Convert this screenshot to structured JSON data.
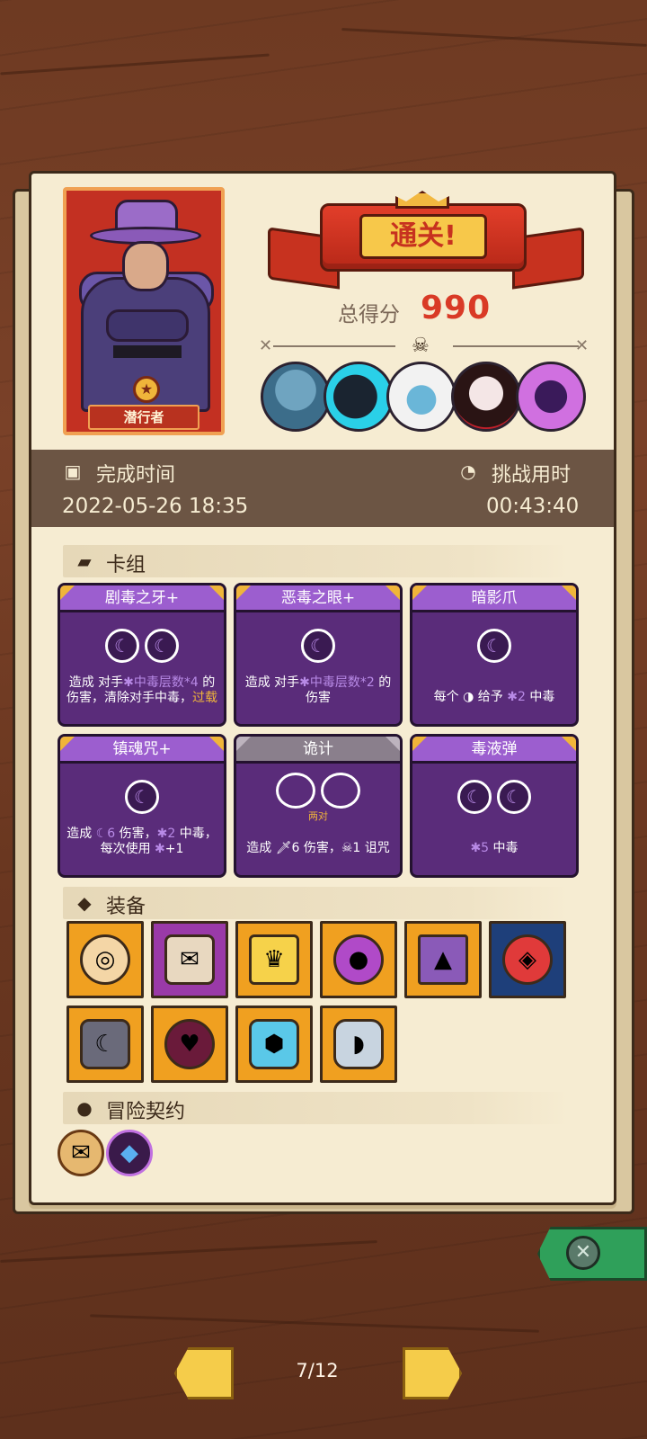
{
  "character": {
    "class_name": "潜行者"
  },
  "result": {
    "banner": "通关!",
    "score_label": "总得分",
    "score_value": "990"
  },
  "bosses": [
    "boss-portrait",
    "boss-portrait",
    "boss-portrait",
    "boss-portrait",
    "boss-portrait"
  ],
  "times": {
    "complete_label": "完成时间",
    "complete_value": "2022-05-26 18:35",
    "challenge_label": "挑战用时",
    "challenge_value": "00:43:40"
  },
  "sections": {
    "deck": "卡组",
    "equipment": "装备",
    "contract": "冒险契约"
  },
  "cards": [
    {
      "name": "剧毒之牙+",
      "orbs": 2,
      "desc_parts": [
        "造成 对手",
        "中毒层数*4",
        " 的伤害，清除对手中毒，",
        "过载"
      ]
    },
    {
      "name": "恶毒之眼+",
      "orbs": 1,
      "desc_parts": [
        "造成 对手",
        "中毒层数*2",
        " 的伤害"
      ]
    },
    {
      "name": "暗影爪",
      "orbs": 1,
      "desc_parts": [
        "每个 ",
        "◑",
        " 给予 ",
        "2",
        " 中毒"
      ]
    },
    {
      "name": "镇魂咒+",
      "orbs": 1,
      "desc_parts": [
        "造成 ",
        "6",
        " 伤害，",
        "2",
        " 中毒，每次使用 ",
        "+1"
      ]
    },
    {
      "name": "诡计",
      "orbs": 2,
      "pair_tag": "两对",
      "desc_parts": [
        "造成 ",
        "6 伤害，",
        "1 诅咒"
      ]
    },
    {
      "name": "毒液弹",
      "orbs": 2,
      "desc_parts": [
        "5",
        " 中毒"
      ]
    }
  ],
  "equipment_icons": [
    "rune-coin-icon",
    "scroll-icon",
    "crown-icon",
    "poison-apple-icon",
    "potion-flask-icon",
    "ruby-gem-icon",
    "moon-stone-icon",
    "cursed-heart-icon",
    "ice-shield-icon",
    "horn-icon"
  ],
  "contracts": [
    "scroll-contract-icon",
    "blue-crystal-icon"
  ],
  "pager": {
    "text": "7/12"
  },
  "colors": {
    "accent_red": "#d93a26",
    "card_purple": "#5a2c7a",
    "banner_gold": "#f7c84a",
    "close_green": "#2fa05a"
  }
}
